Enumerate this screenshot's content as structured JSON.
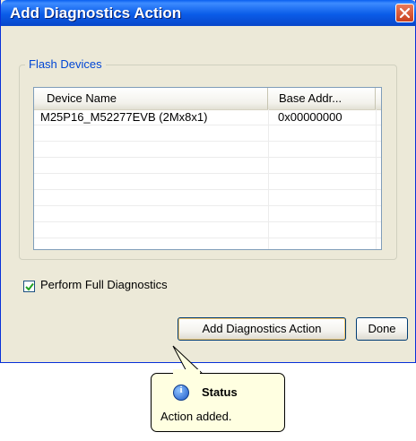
{
  "window": {
    "title": "Add Diagnostics Action"
  },
  "group": {
    "legend": "Flash Devices"
  },
  "table": {
    "columns": [
      "Device Name",
      "Base Addr..."
    ],
    "rows": [
      {
        "device_name": "M25P16_M52277EVB (2Mx8x1)",
        "base_addr": "0x00000000"
      }
    ]
  },
  "checkbox": {
    "label": "Perform Full Diagnostics",
    "checked": true
  },
  "buttons": {
    "add": "Add Diagnostics Action",
    "done": "Done"
  },
  "tooltip": {
    "title": "Status",
    "body": "Action added.",
    "icon": "info-icon"
  },
  "colors": {
    "titlebar": "#0a5ce8",
    "legend": "#0046d5",
    "tooltip_bg": "#ffffe1"
  }
}
